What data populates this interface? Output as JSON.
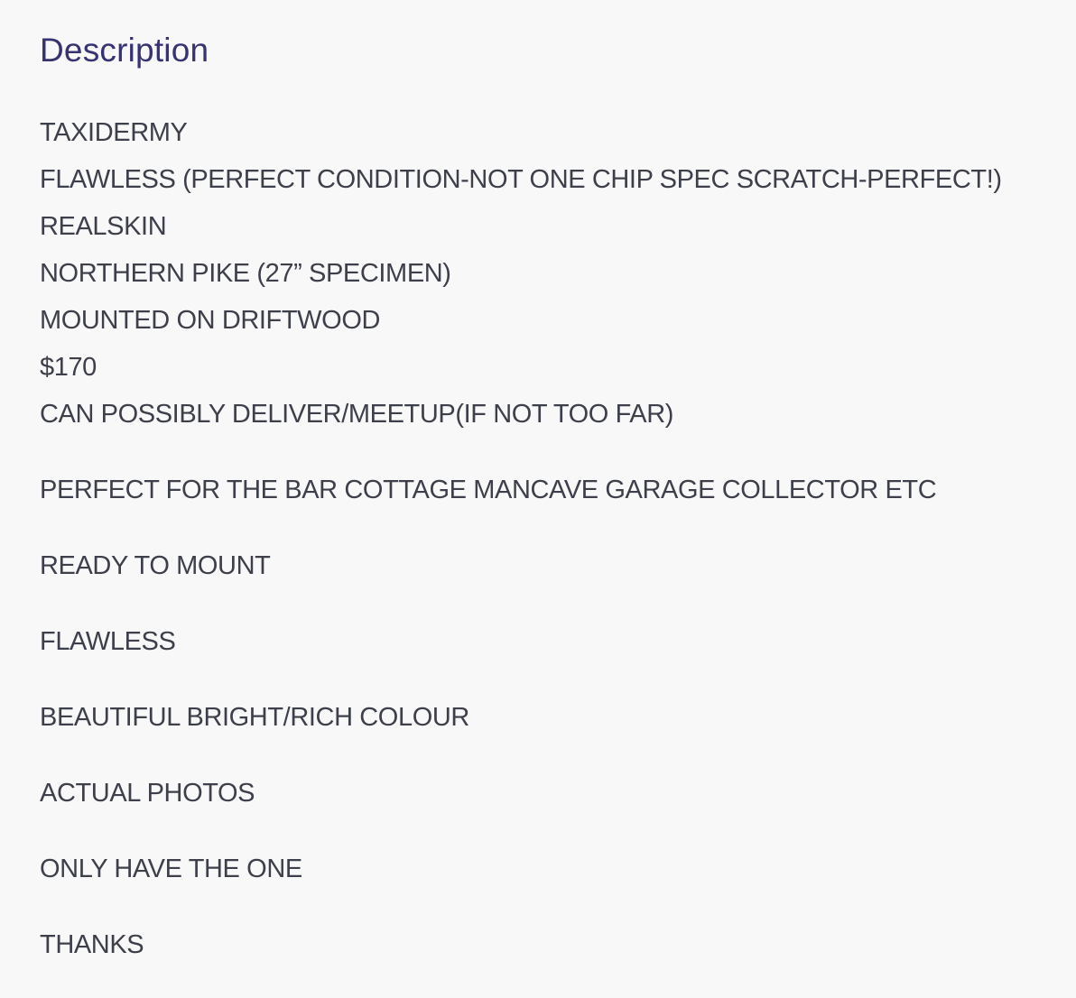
{
  "description": {
    "heading": "Description",
    "intro_lines": [
      "TAXIDERMY",
      "FLAWLESS (PERFECT CONDITION-NOT ONE CHIP SPEC SCRATCH-PERFECT!)",
      "REALSKIN",
      "NORTHERN PIKE (27” SPECIMEN)",
      "MOUNTED ON DRIFTWOOD",
      "$170",
      "CAN POSSIBLY DELIVER/MEETUP(IF NOT TOO FAR)"
    ],
    "paragraphs": [
      "PERFECT FOR THE BAR COTTAGE MANCAVE GARAGE COLLECTOR ETC",
      "READY TO MOUNT",
      "FLAWLESS",
      "BEAUTIFUL BRIGHT/RICH COLOUR",
      "ACTUAL PHOTOS",
      "ONLY HAVE THE ONE",
      "THANKS"
    ]
  }
}
